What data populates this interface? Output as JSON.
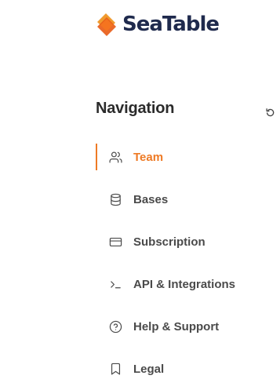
{
  "brand": {
    "name": "SeaTable",
    "color": "#1f2a4d",
    "logo_colors": [
      "#f09a2e",
      "#e85d19"
    ]
  },
  "navigation": {
    "title": "Navigation",
    "refresh_icon": "refresh-icon",
    "accent_color": "#ee7a25",
    "items": [
      {
        "label": "Team",
        "icon": "users-icon",
        "active": true
      },
      {
        "label": "Bases",
        "icon": "database-icon",
        "active": false
      },
      {
        "label": "Subscription",
        "icon": "credit-card-icon",
        "active": false
      },
      {
        "label": "API & Integrations",
        "icon": "terminal-icon",
        "active": false
      },
      {
        "label": "Help & Support",
        "icon": "help-circle-icon",
        "active": false
      },
      {
        "label": "Legal",
        "icon": "bookmark-icon",
        "active": false
      }
    ]
  }
}
